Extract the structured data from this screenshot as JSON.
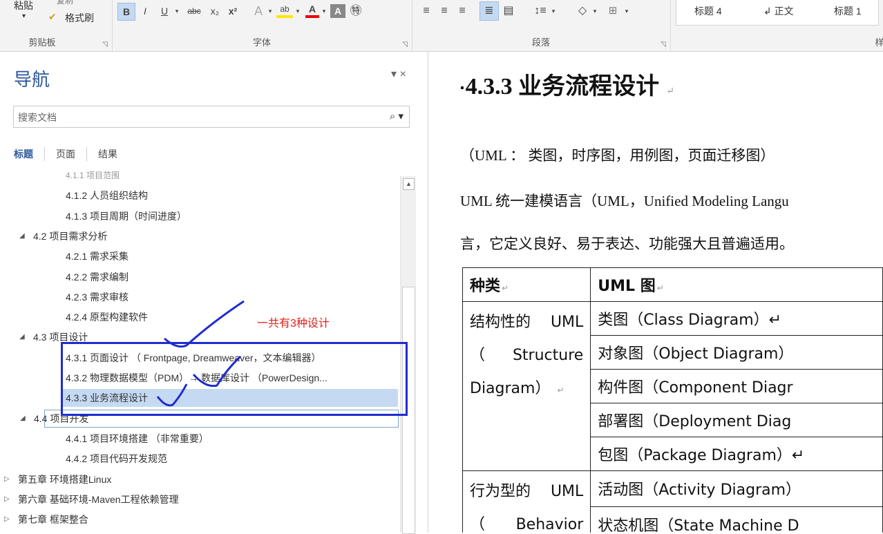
{
  "ribbon": {
    "clipboard": {
      "paste": "粘贴",
      "format_painter": "格式刷",
      "group_label": "剪贴板",
      "top_cut": "复制"
    },
    "font": {
      "group_label": "字体",
      "buttons": [
        "B",
        "I",
        "U",
        "abc",
        "x₂",
        "x²",
        "A",
        "ab",
        "A",
        "A",
        "㊕"
      ]
    },
    "paragraph": {
      "group_label": "段落"
    },
    "styles": {
      "items": [
        "标题 4",
        "↲ 正文",
        "标题 1"
      ],
      "group_label": "样"
    }
  },
  "nav": {
    "title": "导航",
    "close": "▾ ×",
    "search_placeholder": "搜索文档",
    "search_icon": "⌕ ▾",
    "tabs": [
      "标题",
      "页面",
      "结果"
    ],
    "tree": [
      {
        "level": 2,
        "label": "4.1.1 项目范围",
        "state": "partial"
      },
      {
        "level": 2,
        "label": "4.1.2 人员组织结构"
      },
      {
        "level": 2,
        "label": "4.1.3 项目周期（时间进度）"
      },
      {
        "level": 1,
        "label": "4.2 项目需求分析",
        "toggle": "◢"
      },
      {
        "level": 2,
        "label": "4.2.1 需求采集"
      },
      {
        "level": 2,
        "label": "4.2.2 需求编制"
      },
      {
        "level": 2,
        "label": "4.2.3 需求审核"
      },
      {
        "level": 2,
        "label": "4.2.4 原型构建软件"
      },
      {
        "level": 1,
        "label": "4.3 项目设计",
        "toggle": "◢"
      },
      {
        "level": 2,
        "label": "4.3.1 页面设计 （ Frontpage, Dreamweaver，文本编辑器）"
      },
      {
        "level": 2,
        "label": "4.3.2 物理数据模型（PDM）→ 数据库设计 （PowerDesign..."
      },
      {
        "level": 2,
        "label": "4.3.3 业务流程设计",
        "state": "selected"
      },
      {
        "level": 1,
        "label": "4.4 项目开发",
        "toggle": "◢",
        "state": "hover"
      },
      {
        "level": 2,
        "label": "4.4.1 项目环境搭建 （非常重要）"
      },
      {
        "level": 2,
        "label": "4.4.2 项目代码开发规范"
      },
      {
        "level": 0,
        "label": "第五章 环境搭建Linux",
        "toggle": "▷"
      },
      {
        "level": 0,
        "label": "第六章 基础环境-Maven工程依赖管理",
        "toggle": "▷"
      },
      {
        "level": 0,
        "label": "第七章 框架整合",
        "toggle": "▷"
      }
    ]
  },
  "annotation": {
    "note": "一共有3种设计"
  },
  "doc": {
    "heading_bullet": "▪",
    "heading": "4.3.3  业务流程设计",
    "para_mark": "↵",
    "p1": "（UML ：  类图，时序图，用例图，页面迁移图）",
    "p2": "UML 统一建模语言（UML，Unified Modeling Langu",
    "p3": "言，它定义良好、易于表达、功能强大且普遍适用。",
    "table": {
      "headers": [
        "种类",
        "UML 图"
      ],
      "structure": {
        "line1": [
          "结构性的",
          "UML"
        ],
        "line2": [
          "（",
          "Structure"
        ],
        "line3": "Diagram）",
        "diagrams": [
          "类图（Class Diagram）↵",
          "对象图（Object Diagram）",
          "构件图（Component Diagr",
          "部署图（Deployment Diag",
          "包图（Package Diagram）↵"
        ]
      },
      "behavior": {
        "line1": [
          "行为型的",
          "UML"
        ],
        "line2": [
          "（",
          "Behavior"
        ],
        "diagrams": [
          "活动图（Activity Diagram）",
          "状态机图（State Machine D"
        ]
      }
    }
  }
}
